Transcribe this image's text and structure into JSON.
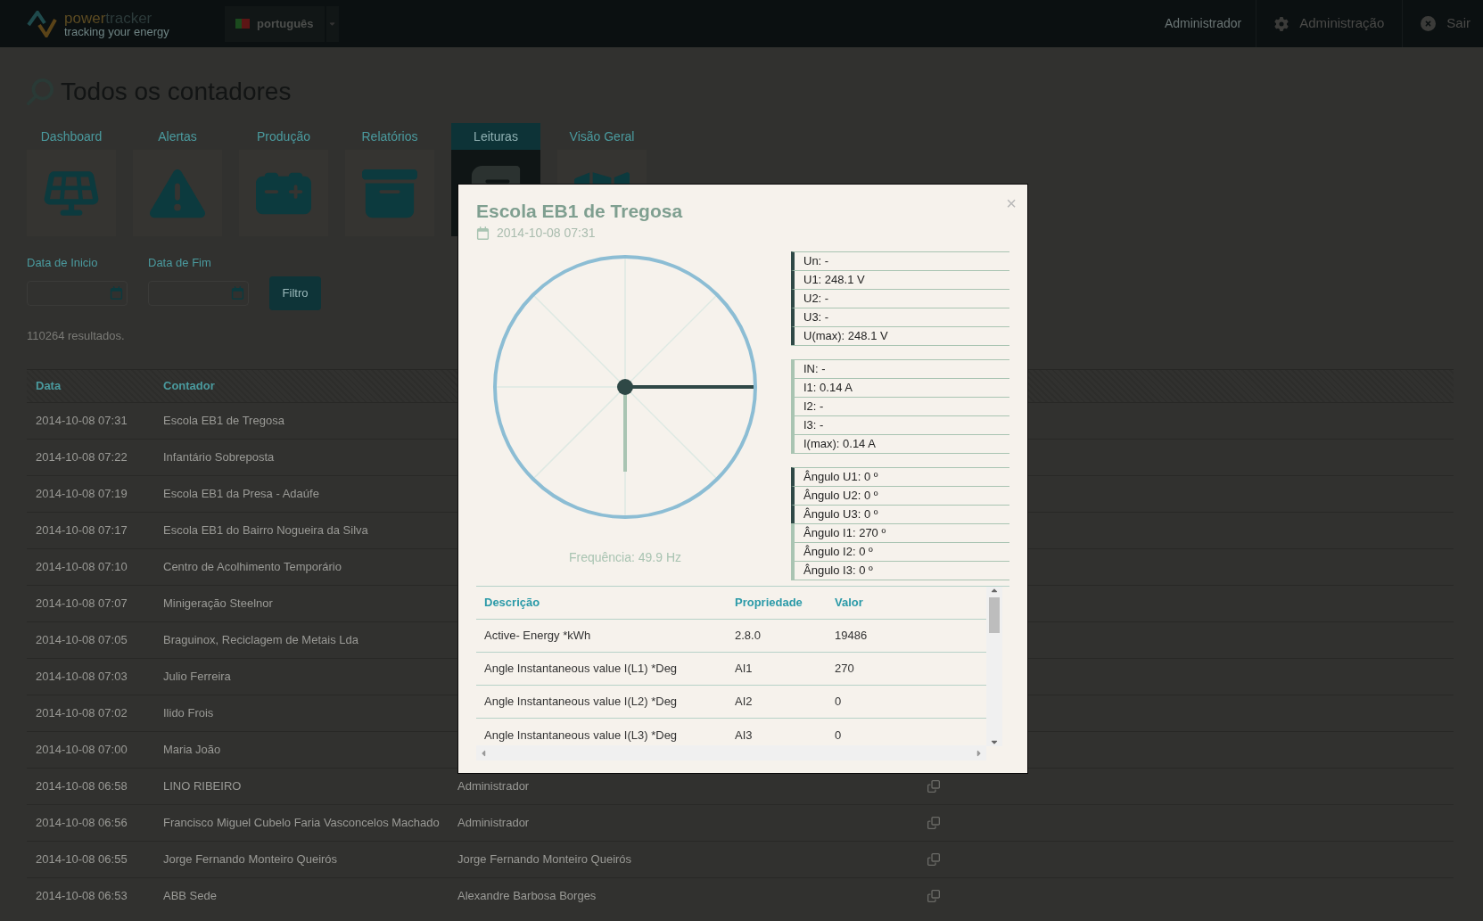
{
  "header": {
    "logo": {
      "word_a": "power",
      "word_b": "tracker",
      "tagline": "tracking your energy"
    },
    "language": "português",
    "user": "Administrador",
    "admin_link": "Administração",
    "logout": "Sair"
  },
  "page_title": "Todos os contadores",
  "tabs": [
    {
      "label": "Dashboard",
      "selected": false
    },
    {
      "label": "Alertas",
      "selected": false
    },
    {
      "label": "Produção",
      "selected": false
    },
    {
      "label": "Relatórios",
      "selected": false
    },
    {
      "label": "Leituras",
      "selected": true
    },
    {
      "label": "Visão Geral",
      "selected": false
    }
  ],
  "filters": {
    "start_label": "Data de Inicio",
    "end_label": "Data de Fim",
    "button": "Filtro"
  },
  "results": "110264 resultados.",
  "table": {
    "columns": [
      "Data",
      "Contador"
    ],
    "rows": [
      {
        "date": "2014-10-08 07:31",
        "meter": "Escola EB1 de Tregosa"
      },
      {
        "date": "2014-10-08 07:22",
        "meter": "Infantário Sobreposta"
      },
      {
        "date": "2014-10-08 07:19",
        "meter": "Escola EB1 da Presa - Adaúfe"
      },
      {
        "date": "2014-10-08 07:17",
        "meter": "Escola EB1 do Bairro Nogueira da Silva"
      },
      {
        "date": "2014-10-08 07:10",
        "meter": "Centro de Acolhimento Temporário"
      },
      {
        "date": "2014-10-08 07:07",
        "meter": "Minigeração Steelnor"
      },
      {
        "date": "2014-10-08 07:05",
        "meter": "Braguinox, Reciclagem de Metais Lda"
      },
      {
        "date": "2014-10-08 07:03",
        "meter": "Julio Ferreira"
      },
      {
        "date": "2014-10-08 07:02",
        "meter": "Ilido Frois"
      },
      {
        "date": "2014-10-08 07:00",
        "meter": "Maria João"
      },
      {
        "date": "2014-10-08 06:58",
        "meter": "LINO RIBEIRO",
        "column_3": "Administrador"
      },
      {
        "date": "2014-10-08 06:56",
        "meter": "Francisco Miguel Cubelo Faria Vasconcelos Machado",
        "column_3": "Administrador"
      },
      {
        "date": "2014-10-08 06:55",
        "meter": "Jorge Fernando Monteiro Queirós",
        "column_3": "Jorge Fernando Monteiro Queirós"
      },
      {
        "date": "2014-10-08 06:53",
        "meter": "ABB Sede",
        "column_3": "Alexandre Barbosa Borges"
      }
    ]
  },
  "modal": {
    "title": "Escola EB1 de Tregosa",
    "date": "2014-10-08 07:31",
    "close": "×",
    "frequency": "Frequência: 49.9 Hz",
    "groups": [
      {
        "items": [
          {
            "text": "Un: -",
            "kind": "voltage"
          },
          {
            "text": "U1: 248.1 V",
            "kind": "voltage"
          },
          {
            "text": "U2: -",
            "kind": "voltage"
          },
          {
            "text": "U3: -",
            "kind": "voltage"
          },
          {
            "text": "U(max): 248.1 V",
            "kind": "voltage"
          }
        ]
      },
      {
        "items": [
          {
            "text": "IN: -",
            "kind": "current"
          },
          {
            "text": "I1: 0.14 A",
            "kind": "current"
          },
          {
            "text": "I2: -",
            "kind": "current"
          },
          {
            "text": "I3: -",
            "kind": "current"
          },
          {
            "text": "I(max): 0.14 A",
            "kind": "current"
          }
        ]
      },
      {
        "items": [
          {
            "text": "Ângulo U1: 0 º",
            "kind": "voltage"
          },
          {
            "text": "Ângulo U2: 0 º",
            "kind": "voltage"
          },
          {
            "text": "Ângulo U3: 0 º",
            "kind": "voltage"
          },
          {
            "text": "Ângulo I1: 270 º",
            "kind": "current"
          },
          {
            "text": "Ângulo I2: 0 º",
            "kind": "current"
          },
          {
            "text": "Ângulo I3: 0 º",
            "kind": "current"
          }
        ]
      }
    ],
    "table": {
      "columns": [
        "Descrição",
        "Propriedade",
        "Valor"
      ],
      "rows": [
        [
          "Active- Energy *kWh",
          "2.8.0",
          "19486"
        ],
        [
          "Angle Instantaneous value I(L1) *Deg",
          "AI1",
          "270"
        ],
        [
          "Angle Instantaneous value I(L2) *Deg",
          "AI2",
          "0"
        ],
        [
          "Angle Instantaneous value I(L3) *Deg",
          "AI3",
          "0"
        ]
      ]
    }
  }
}
